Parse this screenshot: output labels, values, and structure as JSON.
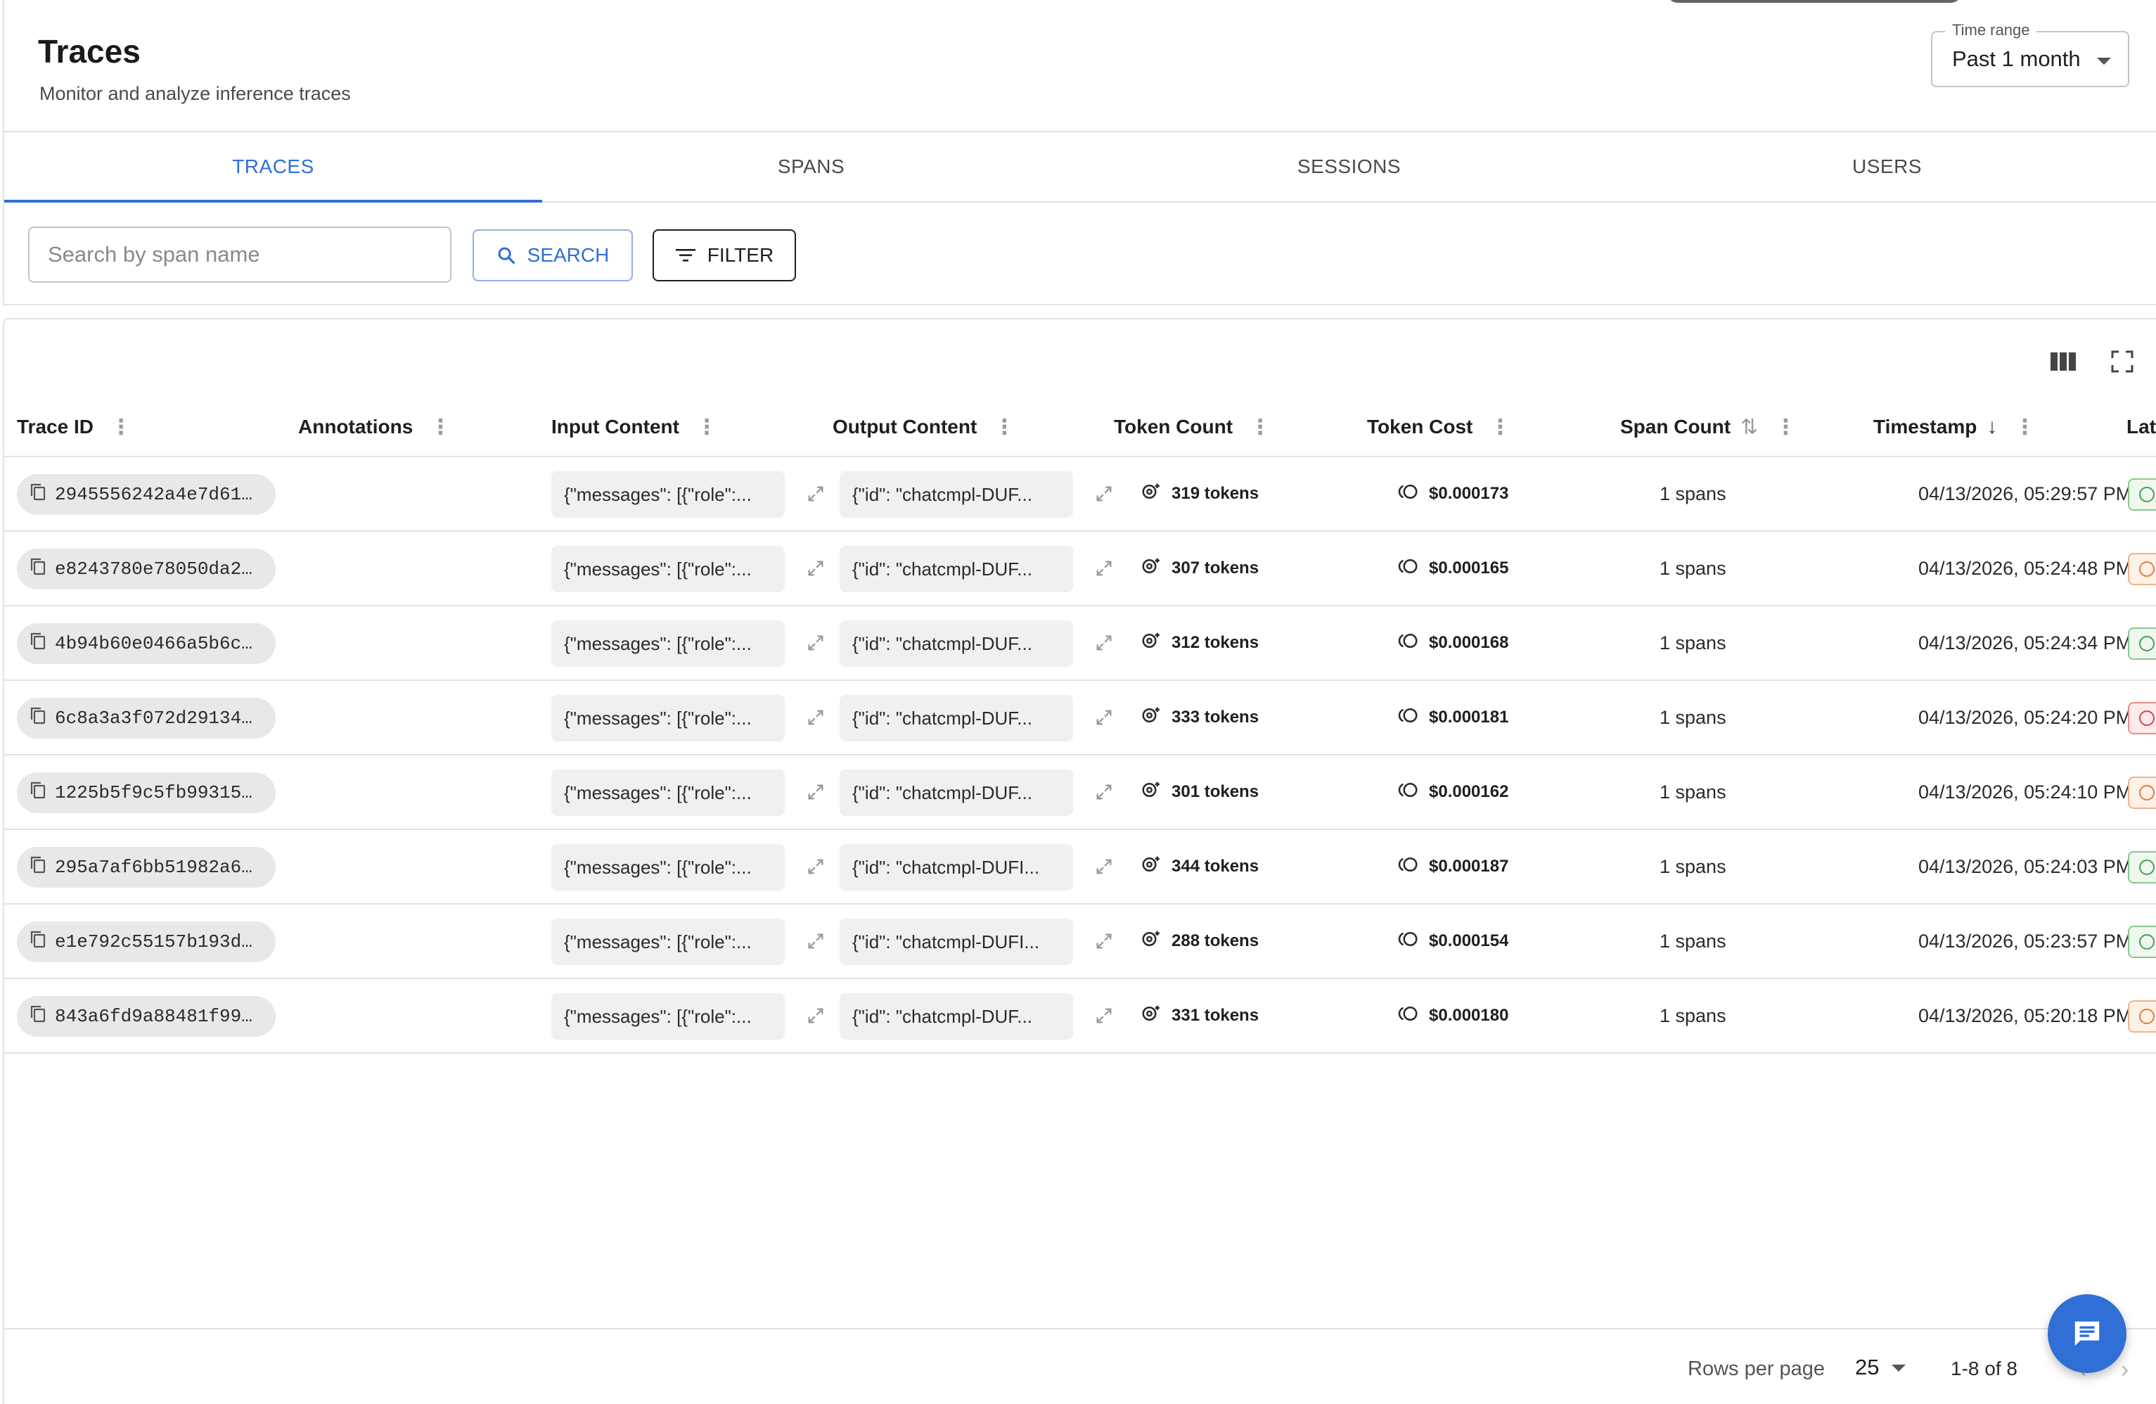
{
  "header": {
    "title": "Traces",
    "subtitle": "Monitor and analyze inference traces",
    "time_range": {
      "label": "Time range",
      "value": "Past 1 month"
    }
  },
  "tabs": [
    {
      "label": "TRACES",
      "active": true
    },
    {
      "label": "SPANS",
      "active": false
    },
    {
      "label": "SESSIONS",
      "active": false
    },
    {
      "label": "USERS",
      "active": false
    }
  ],
  "search": {
    "placeholder": "Search by span name",
    "value": "",
    "search_label": "SEARCH",
    "filter_label": "FILTER"
  },
  "table": {
    "toolbar_icons": [
      "columns-icon",
      "fullscreen-icon"
    ],
    "columns": [
      {
        "label": "Trace ID"
      },
      {
        "label": "Annotations"
      },
      {
        "label": "Input Content"
      },
      {
        "label": "Output Content"
      },
      {
        "label": "Token Count"
      },
      {
        "label": "Token Cost"
      },
      {
        "label": "Span Count",
        "sort": "sortable"
      },
      {
        "label": "Timestamp",
        "sort": "descending"
      },
      {
        "label": "Lat"
      }
    ],
    "rows": [
      {
        "trace_id": "2945556242a4e7d61…",
        "input": "{\"messages\": [{\"role\":...",
        "output": "{\"id\": \"chatcmpl-DUF...",
        "tokens": "319 tokens",
        "cost": "$0.000173",
        "spans": "1 spans",
        "timestamp": "04/13/2026, 05:29:57 PM",
        "latency_status": "green"
      },
      {
        "trace_id": "e8243780e78050da2…",
        "input": "{\"messages\": [{\"role\":...",
        "output": "{\"id\": \"chatcmpl-DUF...",
        "tokens": "307 tokens",
        "cost": "$0.000165",
        "spans": "1 spans",
        "timestamp": "04/13/2026, 05:24:48 PM",
        "latency_status": "orange"
      },
      {
        "trace_id": "4b94b60e0466a5b6c…",
        "input": "{\"messages\": [{\"role\":...",
        "output": "{\"id\": \"chatcmpl-DUF...",
        "tokens": "312 tokens",
        "cost": "$0.000168",
        "spans": "1 spans",
        "timestamp": "04/13/2026, 05:24:34 PM",
        "latency_status": "green"
      },
      {
        "trace_id": "6c8a3a3f072d29134…",
        "input": "{\"messages\": [{\"role\":...",
        "output": "{\"id\": \"chatcmpl-DUF...",
        "tokens": "333 tokens",
        "cost": "$0.000181",
        "spans": "1 spans",
        "timestamp": "04/13/2026, 05:24:20 PM",
        "latency_status": "red"
      },
      {
        "trace_id": "1225b5f9c5fb99315…",
        "input": "{\"messages\": [{\"role\":...",
        "output": "{\"id\": \"chatcmpl-DUF...",
        "tokens": "301 tokens",
        "cost": "$0.000162",
        "spans": "1 spans",
        "timestamp": "04/13/2026, 05:24:10 PM",
        "latency_status": "orange"
      },
      {
        "trace_id": "295a7af6bb51982a6…",
        "input": "{\"messages\": [{\"role\":...",
        "output": "{\"id\": \"chatcmpl-DUFI...",
        "tokens": "344 tokens",
        "cost": "$0.000187",
        "spans": "1 spans",
        "timestamp": "04/13/2026, 05:24:03 PM",
        "latency_status": "green"
      },
      {
        "trace_id": "e1e792c55157b193d…",
        "input": "{\"messages\": [{\"role\":...",
        "output": "{\"id\": \"chatcmpl-DUFI...",
        "tokens": "288 tokens",
        "cost": "$0.000154",
        "spans": "1 spans",
        "timestamp": "04/13/2026, 05:23:57 PM",
        "latency_status": "green"
      },
      {
        "trace_id": "843a6fd9a88481f99…",
        "input": "{\"messages\": [{\"role\":...",
        "output": "{\"id\": \"chatcmpl-DUF...",
        "tokens": "331 tokens",
        "cost": "$0.000180",
        "spans": "1 spans",
        "timestamp": "04/13/2026, 05:20:18 PM",
        "latency_status": "orange"
      }
    ]
  },
  "pagination": {
    "rows_per_page_label": "Rows per page",
    "rows_per_page": "25",
    "range": "1-8 of 8"
  },
  "colors": {
    "accent": "#2f6fd6",
    "latency_green": "#4aa152",
    "latency_orange": "#e47c3a",
    "latency_red": "#d24747"
  }
}
